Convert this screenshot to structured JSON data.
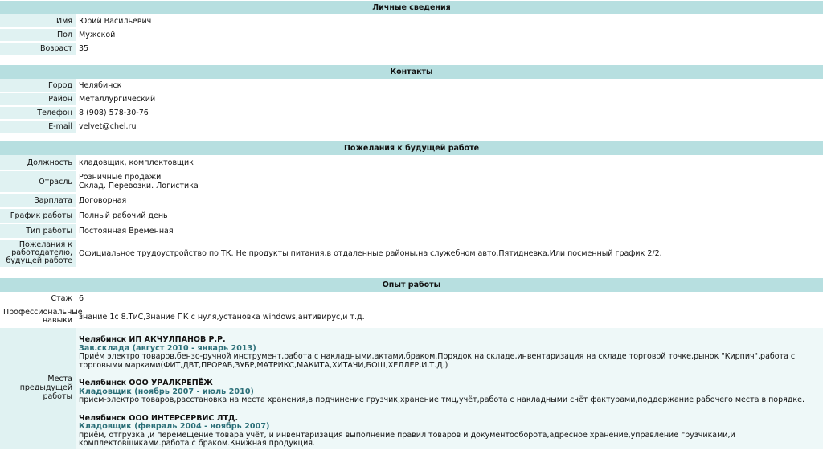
{
  "personal": {
    "header": "Личные сведения",
    "rows": [
      {
        "label": "Имя",
        "value": "Юрий Васильевич"
      },
      {
        "label": "Пол",
        "value": "Мужской"
      },
      {
        "label": "Возраст",
        "value": "35"
      }
    ]
  },
  "contacts": {
    "header": "Контакты",
    "rows": [
      {
        "label": "Город",
        "value": "Челябинск"
      },
      {
        "label": "Район",
        "value": "Металлургический"
      },
      {
        "label": "Телефон",
        "value": "8 (908) 578-30-76"
      },
      {
        "label": "E-mail",
        "value": "velvet@chel.ru"
      }
    ]
  },
  "wishes": {
    "header": "Пожелания к будущей работе",
    "rows": [
      {
        "label": "Должность",
        "value": "кладовщик, комплектовщик"
      },
      {
        "label": "Отрасль",
        "value": "Розничные продажи",
        "value2": "Склад. Перевозки. Логистика"
      },
      {
        "label": "Зарплата",
        "value": "Договорная"
      },
      {
        "label": "График работы",
        "value": "Полный рабочий день"
      },
      {
        "label": "Тип работы",
        "value": "Постоянная Временная"
      },
      {
        "label": "Пожелания к работодателю, будущей работе",
        "value": "Официальное трудоустройство по ТК. Не продукты питания,в отдаленные районы,на служебном авто.Пятидневка.Или посменный график 2/2."
      }
    ]
  },
  "experience": {
    "header": "Опыт работы",
    "rows": [
      {
        "label": "Стаж",
        "value": "6"
      },
      {
        "label": "Профессиональные навыки",
        "value": "знание 1с 8.ТиС,Знание ПК с нуля,установка windows,антивирус,и т.д."
      }
    ],
    "jobs_label": "Места предыдущей работы",
    "jobs": [
      {
        "company": "Челябинск ИП АКЧУЛПАНОВ Р.Р.",
        "position": "Зав.склада (август 2010 - январь 2013)",
        "description": "Приём электро товаров,бензо-ручной инструмент,работа с накладными,актами,браком.Порядок на складе,инвентаризация на складе торговой точке,рынок \"Кирпич\",работа с торговыми марками(ФИТ,ДВТ,ПРОРАБ,ЗУБР,МАТРИКС,МАКИТА,ХИТАЧИ,БОШ,ХЕЛЛЕР,И.Т.Д.)"
      },
      {
        "company": "Челябинск ООО УРАЛКРЕПЁЖ",
        "position": "Кладовщик (ноябрь 2007 - июль 2010)",
        "description": "прием-электро товаров,расстановка на места хранения,в подчинение грузчик,хранение тмц,учёт,работа с накладными счёт фактурами,поддержание рабочего места в порядке."
      },
      {
        "company": "Челябинск ООО ИНТЕРСЕРВИС ЛТД.",
        "position": "Кладовщик (февраль 2004 - ноябрь 2007)",
        "description": "приём, отгрузка ,и перемещение товара учёт, и инвентаризация выполнение правил товаров и документооборота,адресное хранение,управление грузчиками,и комплектовщиками.работа с браком.Книжная продукция."
      }
    ]
  }
}
